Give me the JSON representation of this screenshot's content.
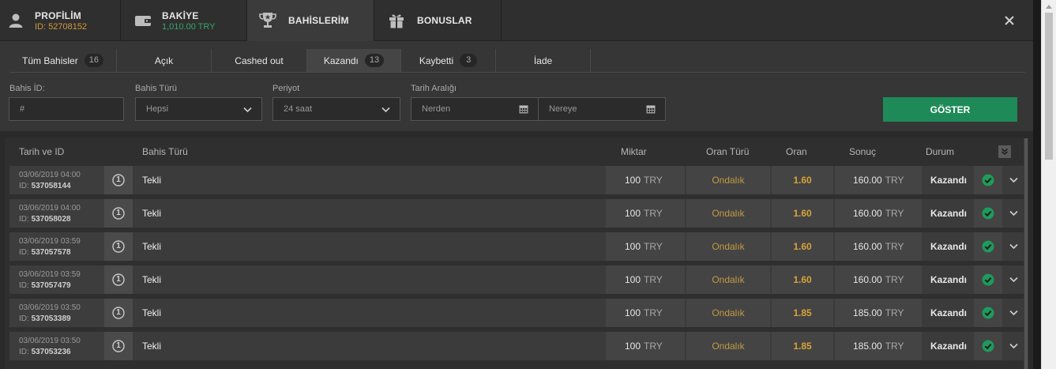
{
  "topbar": {
    "profile": {
      "title": "PROFİLİM",
      "subtitle": "ID: 52708152"
    },
    "balance": {
      "title": "BAKİYE",
      "subtitle": "1,010.00 TRY"
    },
    "mybets": {
      "title": "BAHİSLERİM"
    },
    "bonuses": {
      "title": "BONUSLAR"
    }
  },
  "subtabs": [
    {
      "label": "Tüm Bahisler",
      "count": "16"
    },
    {
      "label": "Açık",
      "count": ""
    },
    {
      "label": "Cashed out",
      "count": ""
    },
    {
      "label": "Kazandı",
      "count": "13"
    },
    {
      "label": "Kaybetti",
      "count": "3"
    },
    {
      "label": "İade",
      "count": ""
    }
  ],
  "filters": {
    "bet_id_label": "Bahis İD:",
    "bet_id_placeholder": "#",
    "bet_type_label": "Bahis Türü",
    "bet_type_value": "Hepsi",
    "period_label": "Periyot",
    "period_value": "24 saat",
    "date_range_label": "Tarih Aralığı",
    "from_placeholder": "Nerden",
    "to_placeholder": "Nereye",
    "show_button": "GÖSTER"
  },
  "table": {
    "headers": {
      "date_id": "Tarih ve ID",
      "bet_type": "Bahis Türü",
      "amount": "Miktar",
      "odds_type": "Oran Türü",
      "odds": "Oran",
      "result": "Sonuç",
      "status": "Durum"
    },
    "rows": [
      {
        "date": "03/06/2019 04:00",
        "id_prefix": "ID:",
        "id": "537058144",
        "num": "1",
        "type": "Tekli",
        "amount": "100",
        "currency": "TRY",
        "odds_type": "Ondalık",
        "odds": "1.60",
        "result": "160.00",
        "status": "Kazandı"
      },
      {
        "date": "03/06/2019 04:00",
        "id_prefix": "ID:",
        "id": "537058028",
        "num": "1",
        "type": "Tekli",
        "amount": "100",
        "currency": "TRY",
        "odds_type": "Ondalık",
        "odds": "1.60",
        "result": "160.00",
        "status": "Kazandı"
      },
      {
        "date": "03/06/2019 03:59",
        "id_prefix": "ID:",
        "id": "537057578",
        "num": "1",
        "type": "Tekli",
        "amount": "100",
        "currency": "TRY",
        "odds_type": "Ondalık",
        "odds": "1.60",
        "result": "160.00",
        "status": "Kazandı"
      },
      {
        "date": "03/06/2019 03:59",
        "id_prefix": "ID:",
        "id": "537057479",
        "num": "1",
        "type": "Tekli",
        "amount": "100",
        "currency": "TRY",
        "odds_type": "Ondalık",
        "odds": "1.60",
        "result": "160.00",
        "status": "Kazandı"
      },
      {
        "date": "03/06/2019 03:50",
        "id_prefix": "ID:",
        "id": "537053389",
        "num": "1",
        "type": "Tekli",
        "amount": "100",
        "currency": "TRY",
        "odds_type": "Ondalık",
        "odds": "1.85",
        "result": "185.00",
        "status": "Kazandı"
      },
      {
        "date": "03/06/2019 03:50",
        "id_prefix": "ID:",
        "id": "537053236",
        "num": "1",
        "type": "Tekli",
        "amount": "100",
        "currency": "TRY",
        "odds_type": "Ondalık",
        "odds": "1.85",
        "result": "185.00",
        "status": "Kazandı"
      }
    ]
  },
  "colors": {
    "accent_green": "#1e8a58",
    "odds_gold": "#d6a339",
    "balance_green": "#35a56b",
    "id_orange": "#d49a3a"
  },
  "icons": {
    "profile": "user-icon",
    "balance": "wallet-icon",
    "mybets": "trophy-icon",
    "bonuses": "gift-icon",
    "close": "close-icon",
    "calendar": "calendar-icon",
    "status": "check-circle-icon",
    "expand": "chevron-down-icon"
  }
}
